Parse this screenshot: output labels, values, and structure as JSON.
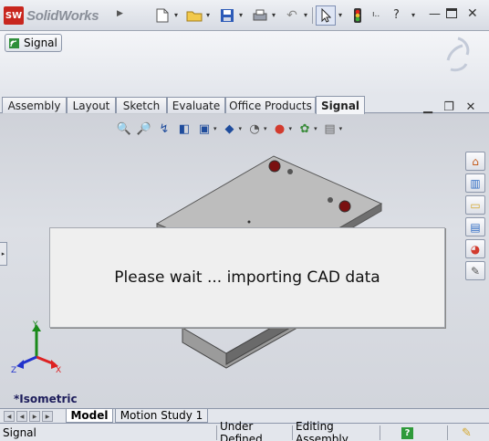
{
  "app": {
    "logo_mark": "SW",
    "name": "SolidWorks"
  },
  "toolbar": {
    "select_arrow": "▾",
    "help_label": "?",
    "overflow_label": "ı.."
  },
  "command_manager": {
    "signal_button_label": "Signal"
  },
  "tabs": [
    {
      "label": "Assembly"
    },
    {
      "label": "Layout"
    },
    {
      "label": "Sketch"
    },
    {
      "label": "Evaluate"
    },
    {
      "label": "Office Products"
    },
    {
      "label": "Signal"
    }
  ],
  "dialog": {
    "message": "Please wait ... importing CAD data"
  },
  "triad": {
    "x": "X",
    "y": "Y",
    "z": "Z"
  },
  "view": {
    "orientation_label": "*Isometric"
  },
  "model_tabs": [
    {
      "label": "Model"
    },
    {
      "label": "Motion Study 1"
    }
  ],
  "status": {
    "document": "Signal",
    "definition": "Under Defined",
    "mode": "Editing Assembly"
  },
  "colors": {
    "accent_red": "#c8261e",
    "viewport_bg": "#d4d7de"
  }
}
